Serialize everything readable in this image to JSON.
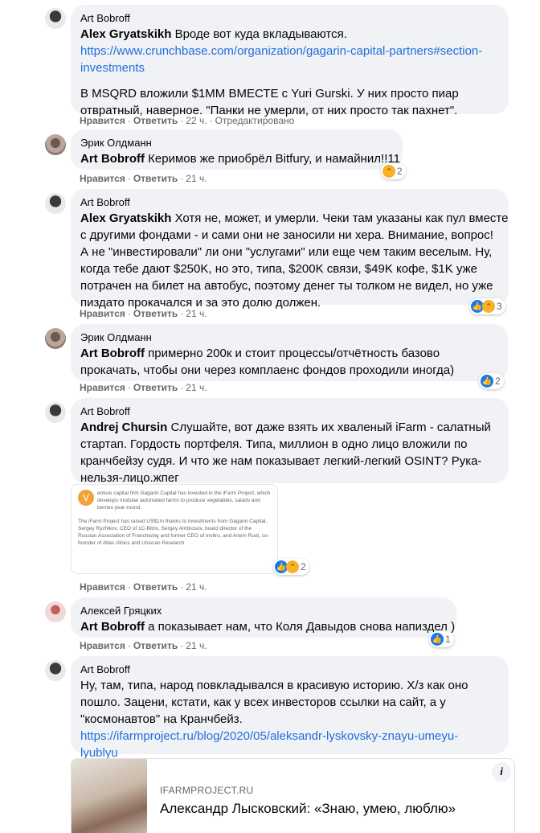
{
  "labels": {
    "like": "Нравится",
    "reply": "Ответить",
    "edited": "Отредактировано",
    "dot": "·"
  },
  "comments": [
    {
      "author": "Art Bobroff",
      "mention": "Alex Gryatskikh",
      "text": "Вроде вот куда вкладываются.",
      "link_line1": "https://www.crunchbase.com/organization/gagarin-capital-partners#section-",
      "link_line2": "investments",
      "text2": "В MSQRD вложили $1MM ВМЕСТЕ с Yuri Gurski. У них просто пиар",
      "text3": "отвратный, наверное. \"Панки не умерли, от них просто так пахнет\".",
      "time": "22 ч."
    },
    {
      "author": "Эрик Олдманн",
      "mention": "Art Bobroff",
      "text": "Керимов же приобрёл Bitfury, и намайнил!!11",
      "time": "21 ч.",
      "reactions": "2"
    },
    {
      "author": "Art Bobroff",
      "mention": "Alex Gryatskikh",
      "lines": [
        "Хотя не, может, и умерли. Чеки там указаны как пул вместе",
        "с другими фондами - и сами они не заносили ни хера. Внимание, вопрос!",
        "А не \"инвестировали\" ли они \"услугами\" или еще чем таким веселым. Ну,",
        "когда тебе дают $250K, но это, типа, $200K связи, $49K кофе, $1K уже",
        "потрачен на билет на автобус, поэтому денег ты толком не видел, но уже",
        "пиздато прокачался и за это долю должен."
      ],
      "time": "21 ч.",
      "reactions": "3"
    },
    {
      "author": "Эрик Олдманн",
      "mention": "Art Bobroff",
      "lines": [
        "примерно 200к и стоит процессы/отчётность базово",
        "прокачать, чтобы они через комплаенс фондов проходили иногда)"
      ],
      "time": "21 ч.",
      "reactions": "2"
    },
    {
      "author": "Art Bobroff",
      "mention": "Andrej Chursin",
      "lines": [
        "Слушайте, вот даже взять их хваленый iFarm - салатный",
        "стартап. Гордость портфеля. Типа, миллион в одно лицо вложили по",
        "кранчбейзу судя. И что же нам показывает легкий-легкий OSINT? Рука-",
        "нельзя-лицо.жпег"
      ],
      "time": "21 ч.",
      "reactions": "2",
      "thumb_text": [
        "enture capital firm Gagarin Capital has invested in the iFarm Project, which develops modular automated farms to produce vegetables, salads and berries year-round.",
        "The iFarm Project has raised US$1m thanks to investments from Gagarin Capital, Sergey Ryzhikov, CEO of 1C-Bitrix, Sergey Ambrosov, board director of the Russian Association of Franchising and former CEO of Invitro, and Artem Rudi, co-founder of Atlas clinics and Uniscan Research"
      ],
      "thumb_logo": "V"
    },
    {
      "author": "Алексей Гряцких",
      "mention": "Art Bobroff",
      "text": "а показывает нам, что Коля Давыдов снова напиздел )",
      "time": "21 ч.",
      "reactions": "1"
    },
    {
      "author": "Art Bobroff",
      "lines": [
        "Ну, там, типа, народ повкладывался в красивую историю. Х/з как оно",
        "пошло. Зацени, кстати, как у всех инвесторов ссылки на сайт, а у",
        "\"космонавтов\" на Кранчбейз."
      ],
      "link_line1": "https://ifarmproject.ru/blog/2020/05/aleksandr-lyskovsky-znayu-umeyu-",
      "link_line2": "lyublyu",
      "card": {
        "domain": "IFARMPROJECT.RU",
        "title": "Александр Лысковский: «Знаю, умею, люблю»",
        "info": "i"
      }
    }
  ]
}
